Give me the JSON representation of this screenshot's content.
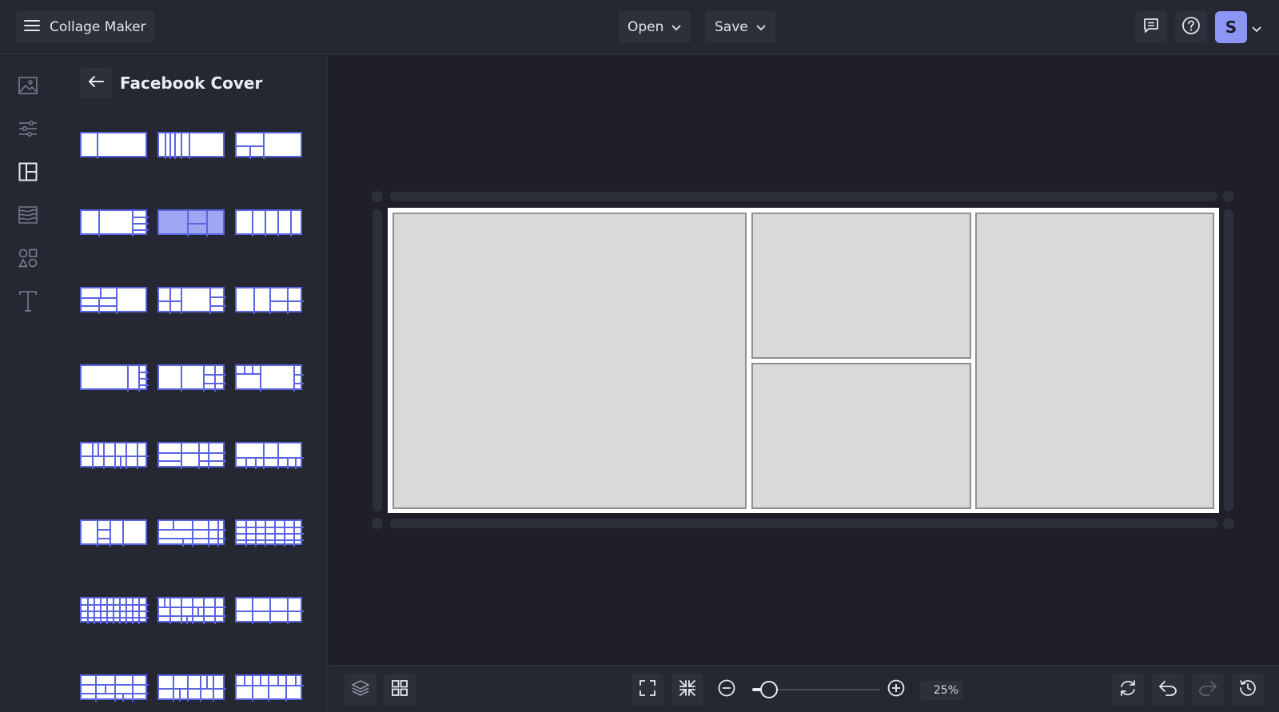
{
  "app": {
    "title": "Collage Maker"
  },
  "header": {
    "open_label": "Open",
    "save_label": "Save",
    "avatar_initial": "S",
    "icons": [
      "menu-icon",
      "chat-icon",
      "help-icon",
      "chevron-down-icon"
    ]
  },
  "rail": {
    "items": [
      "image-icon",
      "adjust-icon",
      "layout-icon",
      "texture-icon",
      "shapes-icon",
      "text-icon"
    ],
    "active": "layout-icon"
  },
  "panel": {
    "title": "Facebook Cover",
    "selected_layout_index": 4,
    "layout_count": 24
  },
  "zoom": {
    "value_label": "25%",
    "level": 0.25
  },
  "colors": {
    "accent": "#5b65e0",
    "selected_fill": "#9ea6f4",
    "avatar": "#8d96f5",
    "cell_fill": "#d9d9d9",
    "panel_bg": "#252733",
    "canvas_bg": "#1e1f28"
  }
}
